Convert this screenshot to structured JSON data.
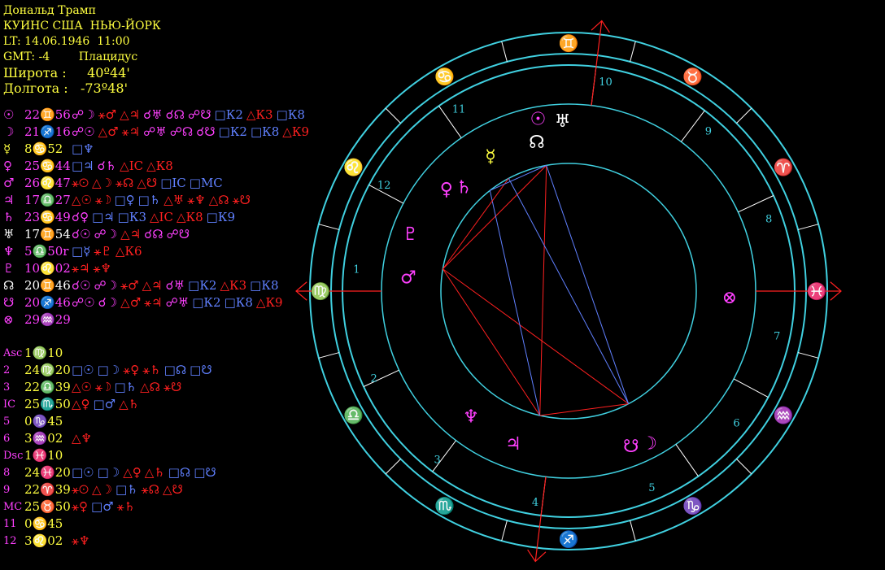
{
  "header": {
    "name": "Дональд Трамп",
    "place": "КУИНС США  НЬЮ-ЙОРК",
    "local_time": "LT: 14.06.1946  11:00",
    "gmt": "GMT: -4",
    "house_system": "Плацидус",
    "latitude_label": "Широта :",
    "latitude_value": "40º44'",
    "longitude_label": "Долгота :",
    "longitude_value": "-73º48'"
  },
  "colors": {
    "yellow": "#ffff40",
    "magenta": "#ff40ff",
    "white": "#ffffff",
    "blue": "#6080ff",
    "red": "#ff2020",
    "cyan": "#40d0e0"
  },
  "planets": [
    {
      "glyph": "☉",
      "color": "#ff40ff",
      "position": "22♊56",
      "aspects": [
        {
          "t": "☍☽",
          "c": "#ff40ff"
        },
        {
          "t": "⚹♂",
          "c": "#ff2020"
        },
        {
          "t": "△♃",
          "c": "#ff2020"
        },
        {
          "t": "☌♅",
          "c": "#ff40ff"
        },
        {
          "t": "☌☊",
          "c": "#ff40ff"
        },
        {
          "t": "☍☋",
          "c": "#ff40ff"
        },
        {
          "t": "□К2",
          "c": "#6080ff"
        },
        {
          "t": "△К3",
          "c": "#ff2020"
        },
        {
          "t": "□К8",
          "c": "#6080ff"
        }
      ]
    },
    {
      "glyph": "☽",
      "color": "#ff40ff",
      "position": "21♐16",
      "aspects": [
        {
          "t": "☍☉",
          "c": "#ff40ff"
        },
        {
          "t": "△♂",
          "c": "#ff2020"
        },
        {
          "t": "⚹♃",
          "c": "#ff2020"
        },
        {
          "t": "☍♅",
          "c": "#ff40ff"
        },
        {
          "t": "☍☊",
          "c": "#ff40ff"
        },
        {
          "t": "☌☋",
          "c": "#ff40ff"
        },
        {
          "t": "□К2",
          "c": "#6080ff"
        },
        {
          "t": "□К8",
          "c": "#6080ff"
        },
        {
          "t": "△К9",
          "c": "#ff2020"
        }
      ]
    },
    {
      "glyph": "☿",
      "color": "#ffff40",
      "position": "8♋52",
      "aspects": [
        {
          "t": "□♆",
          "c": "#6080ff"
        }
      ]
    },
    {
      "glyph": "♀",
      "color": "#ff40ff",
      "position": "25♋44",
      "aspects": [
        {
          "t": "□♃",
          "c": "#6080ff"
        },
        {
          "t": "☌♄",
          "c": "#ff40ff"
        },
        {
          "t": "△IC",
          "c": "#ff2020"
        },
        {
          "t": "△К8",
          "c": "#ff2020"
        }
      ]
    },
    {
      "glyph": "♂",
      "color": "#ff40ff",
      "position": "26♌47",
      "aspects": [
        {
          "t": "⚹☉",
          "c": "#ff2020"
        },
        {
          "t": "△☽",
          "c": "#ff2020"
        },
        {
          "t": "⚹☊",
          "c": "#ff2020"
        },
        {
          "t": "△☋",
          "c": "#ff2020"
        },
        {
          "t": "□IC",
          "c": "#6080ff"
        },
        {
          "t": "□MC",
          "c": "#6080ff"
        }
      ]
    },
    {
      "glyph": "♃",
      "color": "#ff40ff",
      "position": "17♎27",
      "aspects": [
        {
          "t": "△☉",
          "c": "#ff2020"
        },
        {
          "t": "⚹☽",
          "c": "#ff2020"
        },
        {
          "t": "□♀",
          "c": "#6080ff"
        },
        {
          "t": "□♄",
          "c": "#6080ff"
        },
        {
          "t": "△♅",
          "c": "#ff2020"
        },
        {
          "t": "⚹♆",
          "c": "#ff2020"
        },
        {
          "t": "△☊",
          "c": "#ff2020"
        },
        {
          "t": "⚹☋",
          "c": "#ff2020"
        }
      ]
    },
    {
      "glyph": "♄",
      "color": "#ff40ff",
      "position": "23♋49",
      "aspects": [
        {
          "t": "☌♀",
          "c": "#ff40ff"
        },
        {
          "t": "□♃",
          "c": "#6080ff"
        },
        {
          "t": "□К3",
          "c": "#6080ff"
        },
        {
          "t": "△IC",
          "c": "#ff2020"
        },
        {
          "t": "△К8",
          "c": "#ff2020"
        },
        {
          "t": "□К9",
          "c": "#6080ff"
        }
      ]
    },
    {
      "glyph": "♅",
      "color": "#ffffff",
      "position": "17♊54",
      "aspects": [
        {
          "t": "☌☉",
          "c": "#ff40ff"
        },
        {
          "t": "☍☽",
          "c": "#ff40ff"
        },
        {
          "t": "△♃",
          "c": "#ff2020"
        },
        {
          "t": "☌☊",
          "c": "#ff40ff"
        },
        {
          "t": "☍☋",
          "c": "#ff40ff"
        }
      ]
    },
    {
      "glyph": "♆",
      "color": "#ff40ff",
      "position": "5♎50r",
      "aspects": [
        {
          "t": "□☿",
          "c": "#6080ff"
        },
        {
          "t": "⚹♇",
          "c": "#ff2020"
        },
        {
          "t": "△К6",
          "c": "#ff2020"
        }
      ]
    },
    {
      "glyph": "♇",
      "color": "#ff40ff",
      "position": "10♌02",
      "aspects": [
        {
          "t": "⚹♃",
          "c": "#ff2020"
        },
        {
          "t": "⚹♆",
          "c": "#ff2020"
        }
      ]
    },
    {
      "glyph": "☊",
      "color": "#ffffff",
      "position": "20♊46",
      "aspects": [
        {
          "t": "☌☉",
          "c": "#ff40ff"
        },
        {
          "t": "☍☽",
          "c": "#ff40ff"
        },
        {
          "t": "⚹♂",
          "c": "#ff2020"
        },
        {
          "t": "△♃",
          "c": "#ff2020"
        },
        {
          "t": "☌♅",
          "c": "#ff40ff"
        },
        {
          "t": "□К2",
          "c": "#6080ff"
        },
        {
          "t": "△К3",
          "c": "#ff2020"
        },
        {
          "t": "□К8",
          "c": "#6080ff"
        }
      ]
    },
    {
      "glyph": "☋",
      "color": "#ff40ff",
      "position": "20♐46",
      "aspects": [
        {
          "t": "☍☉",
          "c": "#ff40ff"
        },
        {
          "t": "☌☽",
          "c": "#ff40ff"
        },
        {
          "t": "△♂",
          "c": "#ff2020"
        },
        {
          "t": "⚹♃",
          "c": "#ff2020"
        },
        {
          "t": "☍♅",
          "c": "#ff40ff"
        },
        {
          "t": "□К2",
          "c": "#6080ff"
        },
        {
          "t": "□К8",
          "c": "#6080ff"
        },
        {
          "t": "△К9",
          "c": "#ff2020"
        }
      ]
    },
    {
      "glyph": "⊗",
      "color": "#ff40ff",
      "position": "29♒29",
      "aspects": []
    }
  ],
  "cusps": [
    {
      "label": "Asc",
      "position": "1♍10",
      "aspects": []
    },
    {
      "label": "2",
      "position": "24♍20",
      "aspects": [
        {
          "t": "□☉",
          "c": "#6080ff"
        },
        {
          "t": "□☽",
          "c": "#6080ff"
        },
        {
          "t": "⚹♀",
          "c": "#ff2020"
        },
        {
          "t": "⚹♄",
          "c": "#ff2020"
        },
        {
          "t": "□☊",
          "c": "#6080ff"
        },
        {
          "t": "□☋",
          "c": "#6080ff"
        }
      ]
    },
    {
      "label": "3",
      "position": "22♎39",
      "aspects": [
        {
          "t": "△☉",
          "c": "#ff2020"
        },
        {
          "t": "⚹☽",
          "c": "#ff2020"
        },
        {
          "t": "□♄",
          "c": "#6080ff"
        },
        {
          "t": "△☊",
          "c": "#ff2020"
        },
        {
          "t": "⚹☋",
          "c": "#ff2020"
        }
      ]
    },
    {
      "label": "IC",
      "position": "25♏50",
      "aspects": [
        {
          "t": "△♀",
          "c": "#ff2020"
        },
        {
          "t": "□♂",
          "c": "#6080ff"
        },
        {
          "t": "△♄",
          "c": "#ff2020"
        }
      ]
    },
    {
      "label": "5",
      "position": "0♑45",
      "aspects": []
    },
    {
      "label": "6",
      "position": "3♒02",
      "aspects": [
        {
          "t": "△♆",
          "c": "#ff2020"
        }
      ]
    },
    {
      "label": "Dsc",
      "position": "1♓10",
      "aspects": []
    },
    {
      "label": "8",
      "position": "24♓20",
      "aspects": [
        {
          "t": "□☉",
          "c": "#6080ff"
        },
        {
          "t": "□☽",
          "c": "#6080ff"
        },
        {
          "t": "△♀",
          "c": "#ff2020"
        },
        {
          "t": "△♄",
          "c": "#ff2020"
        },
        {
          "t": "□☊",
          "c": "#6080ff"
        },
        {
          "t": "□☋",
          "c": "#6080ff"
        }
      ]
    },
    {
      "label": "9",
      "position": "22♈39",
      "aspects": [
        {
          "t": "⚹☉",
          "c": "#ff2020"
        },
        {
          "t": "△☽",
          "c": "#ff2020"
        },
        {
          "t": "□♄",
          "c": "#6080ff"
        },
        {
          "t": "⚹☊",
          "c": "#ff2020"
        },
        {
          "t": "△☋",
          "c": "#ff2020"
        }
      ]
    },
    {
      "label": "MC",
      "position": "25♉50",
      "aspects": [
        {
          "t": "⚹♀",
          "c": "#ff2020"
        },
        {
          "t": "□♂",
          "c": "#6080ff"
        },
        {
          "t": "⚹♄",
          "c": "#ff2020"
        }
      ]
    },
    {
      "label": "11",
      "position": "0♋45",
      "aspects": []
    },
    {
      "label": "12",
      "position": "3♌02",
      "aspects": [
        {
          "t": "⚹♆",
          "c": "#ff2020"
        }
      ]
    }
  ],
  "wheel": {
    "signs": [
      {
        "name": "gemini",
        "glyph": "♊"
      },
      {
        "name": "taurus",
        "glyph": "♉"
      },
      {
        "name": "aries",
        "glyph": "♈"
      },
      {
        "name": "pisces",
        "glyph": "♓"
      },
      {
        "name": "aquarius",
        "glyph": "♒"
      },
      {
        "name": "capricorn",
        "glyph": "♑"
      },
      {
        "name": "sagittarius",
        "glyph": "♐"
      },
      {
        "name": "scorpio",
        "glyph": "♏"
      },
      {
        "name": "libra",
        "glyph": "♎"
      },
      {
        "name": "virgo",
        "glyph": "♍"
      },
      {
        "name": "leo",
        "glyph": "♌"
      },
      {
        "name": "cancer",
        "glyph": "♋"
      }
    ],
    "house_numbers": [
      "10",
      "9",
      "8",
      "7",
      "6",
      "5",
      "4",
      "3",
      "2",
      "1",
      "12",
      "11"
    ],
    "planet_marks": [
      {
        "name": "sun",
        "glyph": "☉",
        "color": "#ff40ff"
      },
      {
        "name": "uranus",
        "glyph": "♅",
        "color": "#ffffff"
      },
      {
        "name": "north-node",
        "glyph": "☊",
        "color": "#ffffff"
      },
      {
        "name": "mercury",
        "glyph": "☿",
        "color": "#ffff40"
      },
      {
        "name": "venus",
        "glyph": "♀",
        "color": "#ff40ff"
      },
      {
        "name": "saturn",
        "glyph": "♄",
        "color": "#ff40ff"
      },
      {
        "name": "pluto",
        "glyph": "♇",
        "color": "#ff40ff"
      },
      {
        "name": "mars",
        "glyph": "♂",
        "color": "#ff40ff"
      },
      {
        "name": "part-of-fortune",
        "glyph": "⊗",
        "color": "#ff40ff"
      },
      {
        "name": "neptune",
        "glyph": "♆",
        "color": "#ff40ff"
      },
      {
        "name": "jupiter",
        "glyph": "♃",
        "color": "#ff40ff"
      },
      {
        "name": "south-node",
        "glyph": "☋",
        "color": "#ff40ff"
      },
      {
        "name": "moon",
        "glyph": "☽",
        "color": "#ff40ff"
      }
    ]
  }
}
